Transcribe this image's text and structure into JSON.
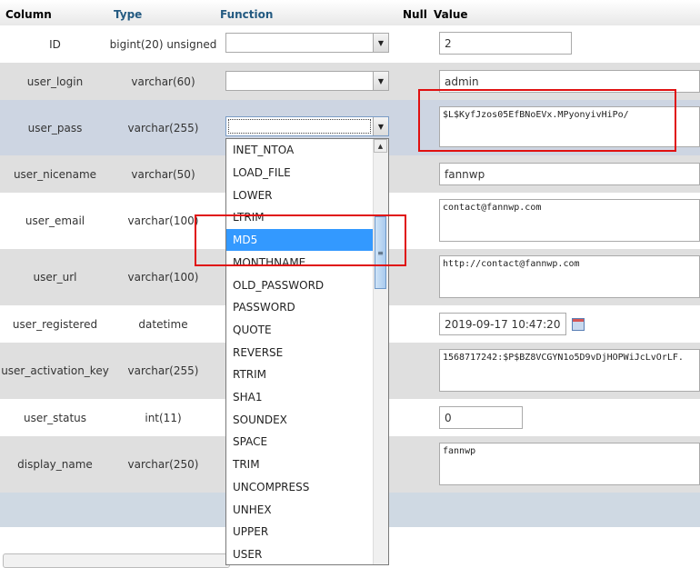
{
  "header": {
    "column": "Column",
    "type": "Type",
    "function": "Function",
    "null": "Null",
    "value": "Value"
  },
  "rows": [
    {
      "name": "ID",
      "type": "bigint(20) unsigned",
      "value": "2"
    },
    {
      "name": "user_login",
      "type": "varchar(60)",
      "value": "admin"
    },
    {
      "name": "user_pass",
      "type": "varchar(255)",
      "value": "$L$KyfJzos05EfBNoEVx.MPyonyivHiPo/"
    },
    {
      "name": "user_nicename",
      "type": "varchar(50)",
      "value": "fannwp"
    },
    {
      "name": "user_email",
      "type": "varchar(100)",
      "value": "contact@fannwp.com"
    },
    {
      "name": "user_url",
      "type": "varchar(100)",
      "value": "http://contact@fannwp.com"
    },
    {
      "name": "user_registered",
      "type": "datetime",
      "value": "2019-09-17 10:47:20"
    },
    {
      "name": "user_activation_key",
      "type": "varchar(255)",
      "value": "1568717242:$P$BZ8VCGYN1o5D9vDjHOPWiJcLvOrLF."
    },
    {
      "name": "user_status",
      "type": "int(11)",
      "value": "0"
    },
    {
      "name": "display_name",
      "type": "varchar(250)",
      "value": "fannwp"
    }
  ],
  "dropdown": {
    "items": [
      "INET_NTOA",
      "LOAD_FILE",
      "LOWER",
      "LTRIM",
      "MD5",
      "MONTHNAME",
      "OLD_PASSWORD",
      "PASSWORD",
      "QUOTE",
      "REVERSE",
      "RTRIM",
      "SHA1",
      "SOUNDEX",
      "SPACE",
      "TRIM",
      "UNCOMPRESS",
      "UNHEX",
      "UPPER",
      "USER"
    ],
    "selected": "MD5"
  },
  "colors": {
    "highlight": "#3399ff",
    "annotation": "#e01010",
    "header_link": "#235a81"
  }
}
